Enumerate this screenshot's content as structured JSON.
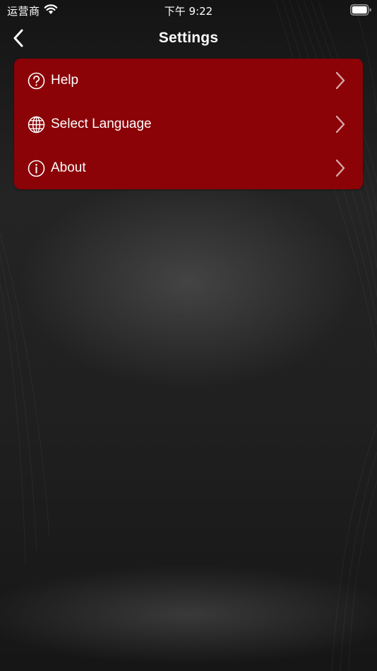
{
  "status_bar": {
    "carrier": "运营商",
    "time": "下午 9:22",
    "wifi_icon": "wifi-icon",
    "battery_icon": "battery-full-icon"
  },
  "nav": {
    "title": "Settings",
    "back_icon": "chevron-left-icon"
  },
  "menu": {
    "items": [
      {
        "label": "Help",
        "icon": "question-circle-icon"
      },
      {
        "label": "Select Language",
        "icon": "globe-icon"
      },
      {
        "label": "About",
        "icon": "info-circle-icon"
      }
    ],
    "chevron_icon": "chevron-right-icon"
  },
  "colors": {
    "card_background": "#8b0207",
    "page_background": "#1f1f1f",
    "text": "#ffffff"
  }
}
